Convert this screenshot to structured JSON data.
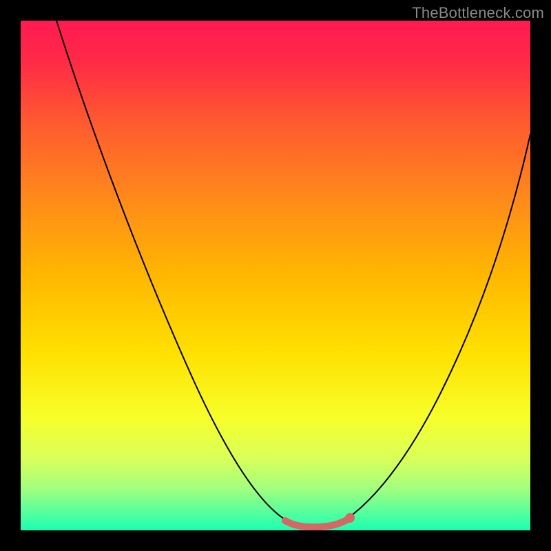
{
  "watermark": "TheBottleneck.com",
  "chart_data": {
    "type": "line",
    "title": "",
    "xlabel": "",
    "ylabel": "",
    "background": "rainbow-gradient",
    "x_range": [
      0,
      100
    ],
    "y_range": [
      0,
      100
    ],
    "series": [
      {
        "name": "bottleneck-curve-left",
        "x": [
          7,
          10,
          15,
          20,
          25,
          30,
          35,
          40,
          45,
          50,
          53
        ],
        "values": [
          100,
          93,
          82,
          70,
          58,
          46,
          34,
          22,
          11,
          3,
          1
        ]
      },
      {
        "name": "bottleneck-curve-right",
        "x": [
          63,
          66,
          70,
          75,
          80,
          85,
          90,
          95,
          100
        ],
        "values": [
          1,
          3,
          8,
          17,
          29,
          42,
          55,
          67,
          78
        ]
      },
      {
        "name": "optimal-trough",
        "x": [
          52,
          55,
          58,
          61,
          64
        ],
        "values": [
          1.5,
          0.7,
          0.5,
          0.7,
          1.5
        ],
        "style": "highlight"
      }
    ],
    "marker": {
      "x": 64.5,
      "y": 2
    },
    "gradient_stops": [
      {
        "offset": 0.0,
        "color": "#ff1a52"
      },
      {
        "offset": 0.08,
        "color": "#ff2a46"
      },
      {
        "offset": 0.2,
        "color": "#ff5a30"
      },
      {
        "offset": 0.35,
        "color": "#ff8a1a"
      },
      {
        "offset": 0.5,
        "color": "#ffb700"
      },
      {
        "offset": 0.65,
        "color": "#ffe000"
      },
      {
        "offset": 0.78,
        "color": "#f7ff2a"
      },
      {
        "offset": 0.86,
        "color": "#d8ff5a"
      },
      {
        "offset": 0.92,
        "color": "#9fff80"
      },
      {
        "offset": 0.97,
        "color": "#4dffa0"
      },
      {
        "offset": 1.0,
        "color": "#1affb0"
      }
    ]
  }
}
